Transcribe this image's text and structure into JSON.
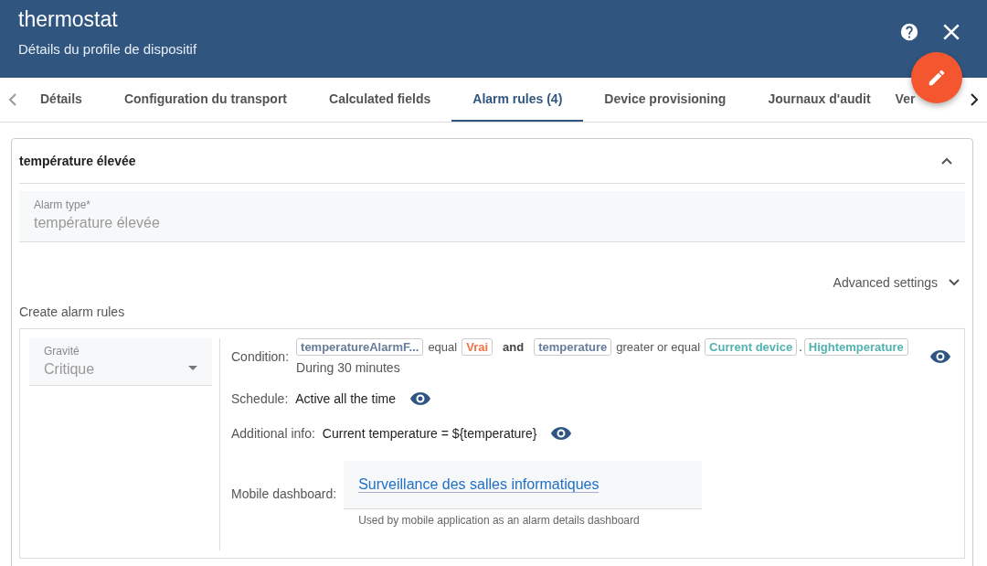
{
  "header": {
    "title": "thermostat",
    "subtitle": "Détails du profile de dispositif"
  },
  "tabs": [
    {
      "label": "Détails",
      "selected": false
    },
    {
      "label": "Configuration du transport",
      "selected": false
    },
    {
      "label": "Calculated fields",
      "selected": false
    },
    {
      "label": "Alarm rules (4)",
      "selected": true
    },
    {
      "label": "Device provisioning",
      "selected": false
    },
    {
      "label": "Journaux d'audit",
      "selected": false
    },
    {
      "label": "Ver",
      "selected": false
    }
  ],
  "alarm": {
    "title": "température élevée",
    "expanded": true,
    "alarm_type": {
      "label": "Alarm type*",
      "value": "température élevée"
    },
    "advanced_settings": "Advanced settings",
    "create_rules_label": "Create alarm rules",
    "rule": {
      "severity": {
        "label": "Gravité",
        "value": "Critique"
      },
      "condition_label": "Condition:",
      "condition": [
        {
          "kind": "key",
          "text": "temperatureAlarmF..."
        },
        {
          "kind": "text",
          "text": "equal"
        },
        {
          "kind": "value",
          "text": "Vrai"
        },
        {
          "kind": "operator",
          "text": "and"
        },
        {
          "kind": "key",
          "text": "temperature"
        },
        {
          "kind": "text",
          "text": "greater or equal"
        },
        {
          "kind": "constant",
          "text": "Current device"
        },
        {
          "kind": "dot",
          "text": "."
        },
        {
          "kind": "constant",
          "text": "Hightemperature"
        }
      ],
      "duration": "During 30 minutes",
      "schedule_label": "Schedule:",
      "schedule": "Active all the time",
      "info_label": "Additional info:",
      "info": "Current temperature = ${temperature}",
      "dashboard_label": "Mobile dashboard:",
      "dashboard": "Surveillance des salles informatiques",
      "dashboard_hint": "Used by mobile application as an alarm details dashboard"
    }
  }
}
